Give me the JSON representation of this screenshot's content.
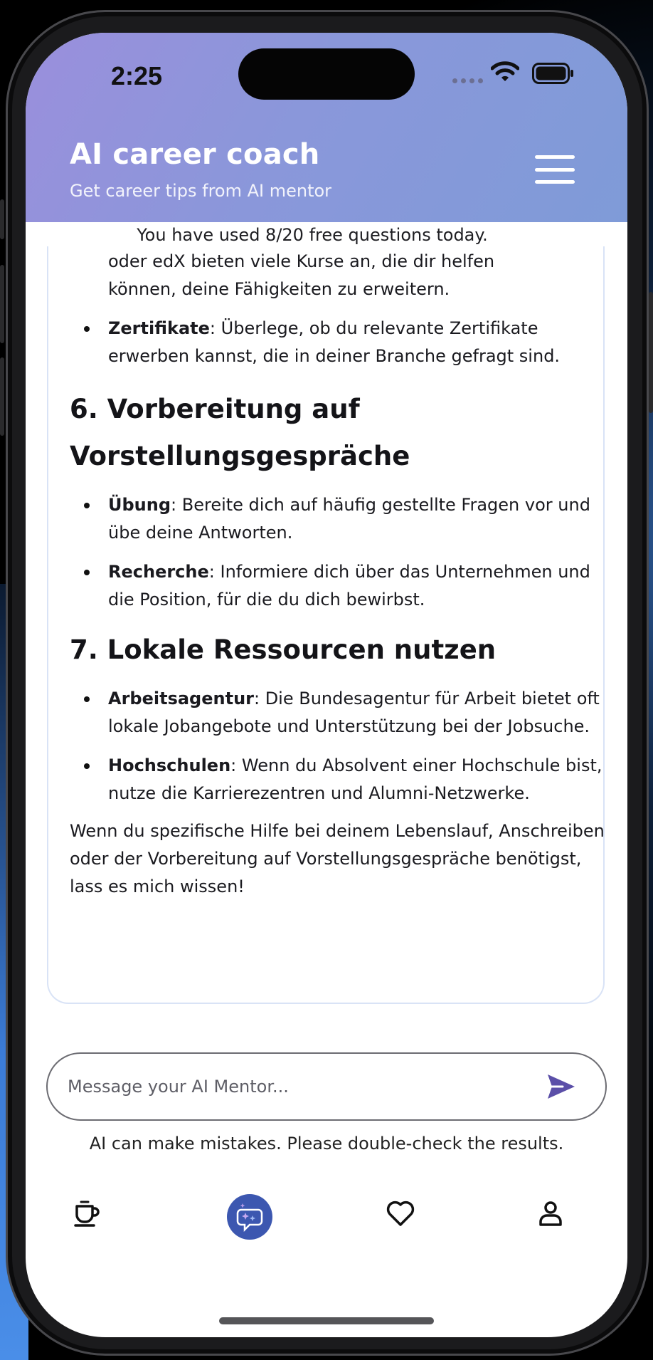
{
  "status_bar": {
    "time": "2:25"
  },
  "header": {
    "title": "AI career coach",
    "subtitle": "Get career tips from AI mentor"
  },
  "usage_notice": "You have used 8/20 free questions today.",
  "message": {
    "cont_line_1": "oder edX bieten viele Kurse an, die dir helfen",
    "cont_line_2": "können, deine Fähigkeiten zu erweitern.",
    "bullets_a": [
      {
        "term": "Zertifikate",
        "text": ": Überlege, ob du relevante Zertifikate erwerben kannst, die in deiner Branche gefragt sind."
      }
    ],
    "section_6": "6. Vorbereitung auf Vorstellungsgespräche",
    "bullets_6": [
      {
        "term": "Übung",
        "text": ": Bereite dich auf häufig gestellte Fragen vor und übe deine Antworten."
      },
      {
        "term": "Recherche",
        "text": ": Informiere dich über das Unternehmen und die Position, für die du dich bewirbst."
      }
    ],
    "section_7": "7. Lokale Ressourcen nutzen",
    "bullets_7": [
      {
        "term": "Arbeitsagentur",
        "text": ": Die Bundesagentur für Arbeit bietet oft lokale Jobangebote und Unterstützung bei der Jobsuche."
      },
      {
        "term": "Hochschulen",
        "text": ": Wenn du Absolvent einer Hochschule bist, nutze die Karrierezentren und Alumni-Netzwerke."
      }
    ],
    "closing": "Wenn du spezifische Hilfe bei deinem Lebenslauf, Anschreiben oder der Vorbereitung auf Vorstellungsgespräche benötigst, lass es mich wissen!"
  },
  "composer": {
    "placeholder": "Message your AI Mentor...",
    "value": ""
  },
  "disclaimer": "AI can make mistakes. Please double-check the results.",
  "bottom_nav": {
    "items": [
      "coffee-cup",
      "ai-chat",
      "favorites",
      "profile"
    ],
    "active": "ai-chat"
  },
  "colors": {
    "header_gradient_start": "#9a8fdc",
    "header_gradient_end": "#7f9bd8",
    "accent": "#5b4fa8",
    "active_nav": "#3c57b0"
  }
}
